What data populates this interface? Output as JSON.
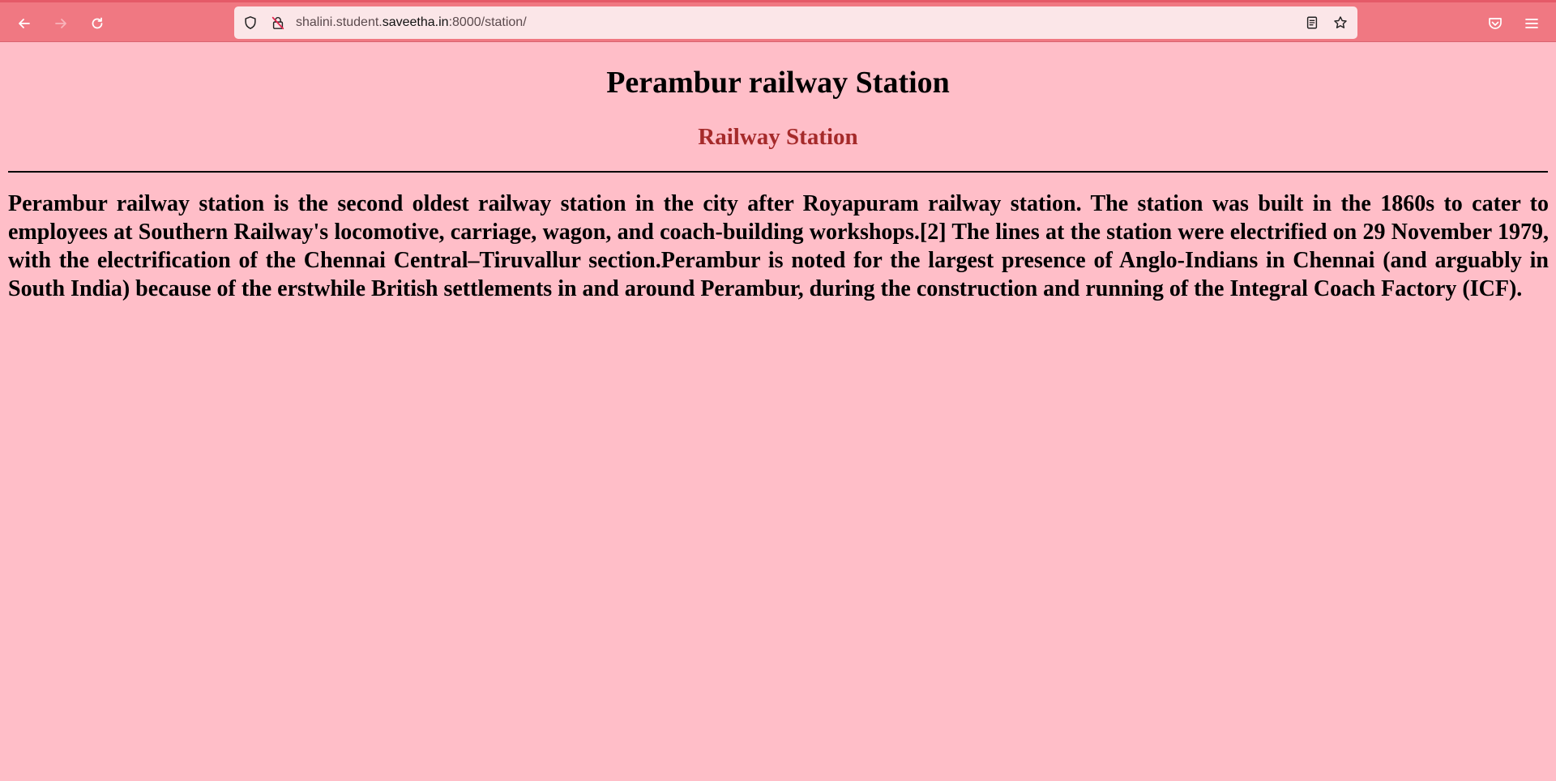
{
  "browser": {
    "url_prefix": "shalini.student.",
    "url_host": "saveetha.in",
    "url_suffix": ":8000/station/",
    "icons": {
      "back": "arrow-left-icon",
      "forward": "arrow-right-icon",
      "reload": "reload-icon",
      "tracking": "shield-icon",
      "insecure": "insecure-lock-icon",
      "reader": "reader-view-icon",
      "bookmark": "star-icon",
      "pocket": "pocket-icon",
      "menu": "hamburger-menu-icon"
    },
    "colors": {
      "toolbar": "#f07882",
      "urlbar": "#fbe6e8",
      "page_background": "#ffbec8",
      "subtitle": "#a52a2a"
    }
  },
  "page": {
    "title": "Perambur railway Station",
    "subtitle": "Railway Station",
    "body": "Perambur railway station is the second oldest railway station in the city after Royapuram railway station. The station was built in the 1860s to cater to employees at Southern Railway's locomotive, carriage, wagon, and coach-building workshops.[2] The lines at the station were electrified on 29 November 1979, with the electrification of the Chennai Central–Tiruvallur section.Perambur is noted for the largest presence of Anglo-Indians in Chennai (and arguably in South India) because of the erstwhile British settlements in and around Perambur, during the construction and running of the Integral Coach Factory (ICF)."
  }
}
